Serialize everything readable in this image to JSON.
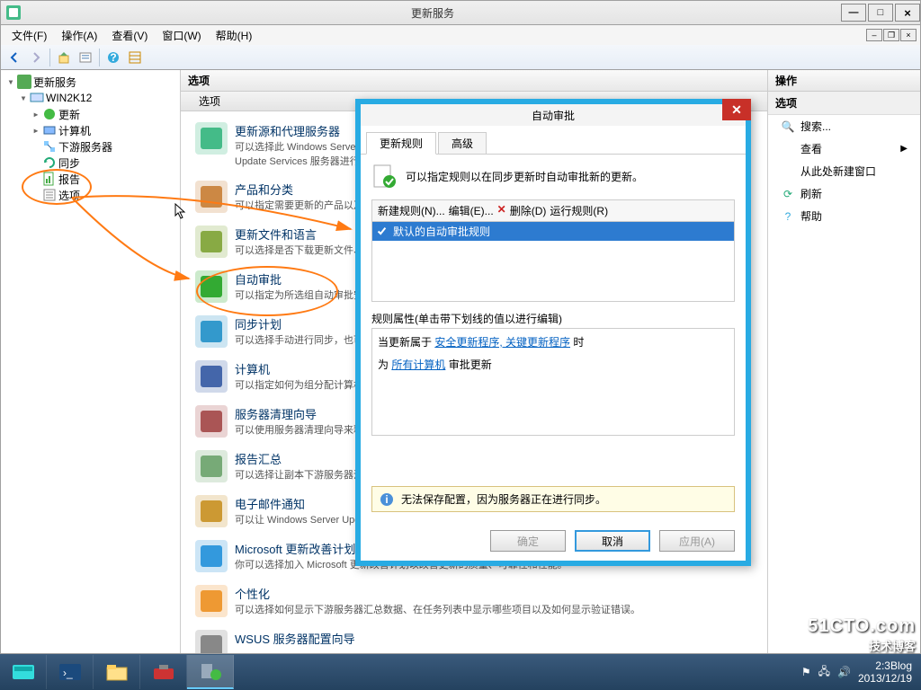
{
  "window": {
    "title": "更新服务",
    "win_min": "—",
    "win_max": "□",
    "win_close": "×"
  },
  "menu": {
    "file": "文件(F)",
    "action": "操作(A)",
    "view": "查看(V)",
    "window": "窗口(W)",
    "help": "帮助(H)"
  },
  "tree": {
    "root": "更新服务",
    "server": "WIN2K12",
    "items": [
      "更新",
      "计算机",
      "下游服务器",
      "同步",
      "报告",
      "选项"
    ]
  },
  "content": {
    "header": "选项",
    "subheader": "选项",
    "opts": [
      {
        "t": "更新源和代理服务器",
        "d": "可以选择此 Windows Server Update Services 服务器是与 Microsoft 更新还是与你网络上的上游 Windows Server Update Services 服务器进行同步。"
      },
      {
        "t": "产品和分类",
        "d": "可以指定需要更新的产品以及所需的更新类型。"
      },
      {
        "t": "更新文件和语言",
        "d": "可以选择是否下载更新文件、更新文件的存储位置以及要下载的更新语言。"
      },
      {
        "t": "自动审批",
        "d": "可以指定为所选组自动审批安装更新的方式以及如何审批对现有更新的修订。"
      },
      {
        "t": "同步计划",
        "d": "可以选择手动进行同步，也可以设置每日自动同步的计划。"
      },
      {
        "t": "计算机",
        "d": "可以指定如何为组分配计算机。"
      },
      {
        "t": "服务器清理向导",
        "d": "可以使用服务器清理向导来释放旧计算机、更新和更新文件占用的磁盘空间。"
      },
      {
        "t": "报告汇总",
        "d": "可以选择让副本下游服务器汇总计算机和更新状态。"
      },
      {
        "t": "电子邮件通知",
        "d": "可以让 Windows Server Update Services 发送新更新和状态报告的电子邮件通知。"
      },
      {
        "t": "Microsoft 更新改善计划",
        "d": "你可以选择加入 Microsoft 更新改善计划以改善更新的质量、可靠性和性能。"
      },
      {
        "t": "个性化",
        "d": "可以选择如何显示下游服务器汇总数据、在任务列表中显示哪些项目以及如何显示验证错误。"
      },
      {
        "t": "WSUS 服务器配置向导",
        "d": ""
      }
    ]
  },
  "actions": {
    "header": "操作",
    "sub": "选项",
    "acts": [
      "搜索...",
      "查看",
      "从此处新建窗口",
      "刷新",
      "帮助"
    ]
  },
  "dialog": {
    "title": "自动审批",
    "tabs": [
      "更新规则",
      "高级"
    ],
    "info": "可以指定规则以在同步更新时自动审批新的更新。",
    "toolbar": {
      "new": "新建规则(N)...",
      "edit": "编辑(E)...",
      "delete": "删除(D)",
      "run": "运行规则(R)"
    },
    "rule_name": "默认的自动审批规则",
    "props_label": "规则属性(单击带下划线的值以进行编辑)",
    "props": {
      "line1_a": "当更新属于",
      "line1_link": "安全更新程序, 关键更新程序",
      "line1_b": "时",
      "line2_a": "为",
      "line2_link": "所有计算机",
      "line2_b": "审批更新"
    },
    "warning": "无法保存配置，因为服务器正在进行同步。",
    "btns": {
      "ok": "确定",
      "cancel": "取消",
      "apply": "应用(A)"
    }
  },
  "taskbar": {
    "time": "2:3",
    "date": "2013/12/19",
    "blog": "Blog"
  },
  "watermark": {
    "l1": "51CTO.com",
    "l2": "技术博客"
  }
}
